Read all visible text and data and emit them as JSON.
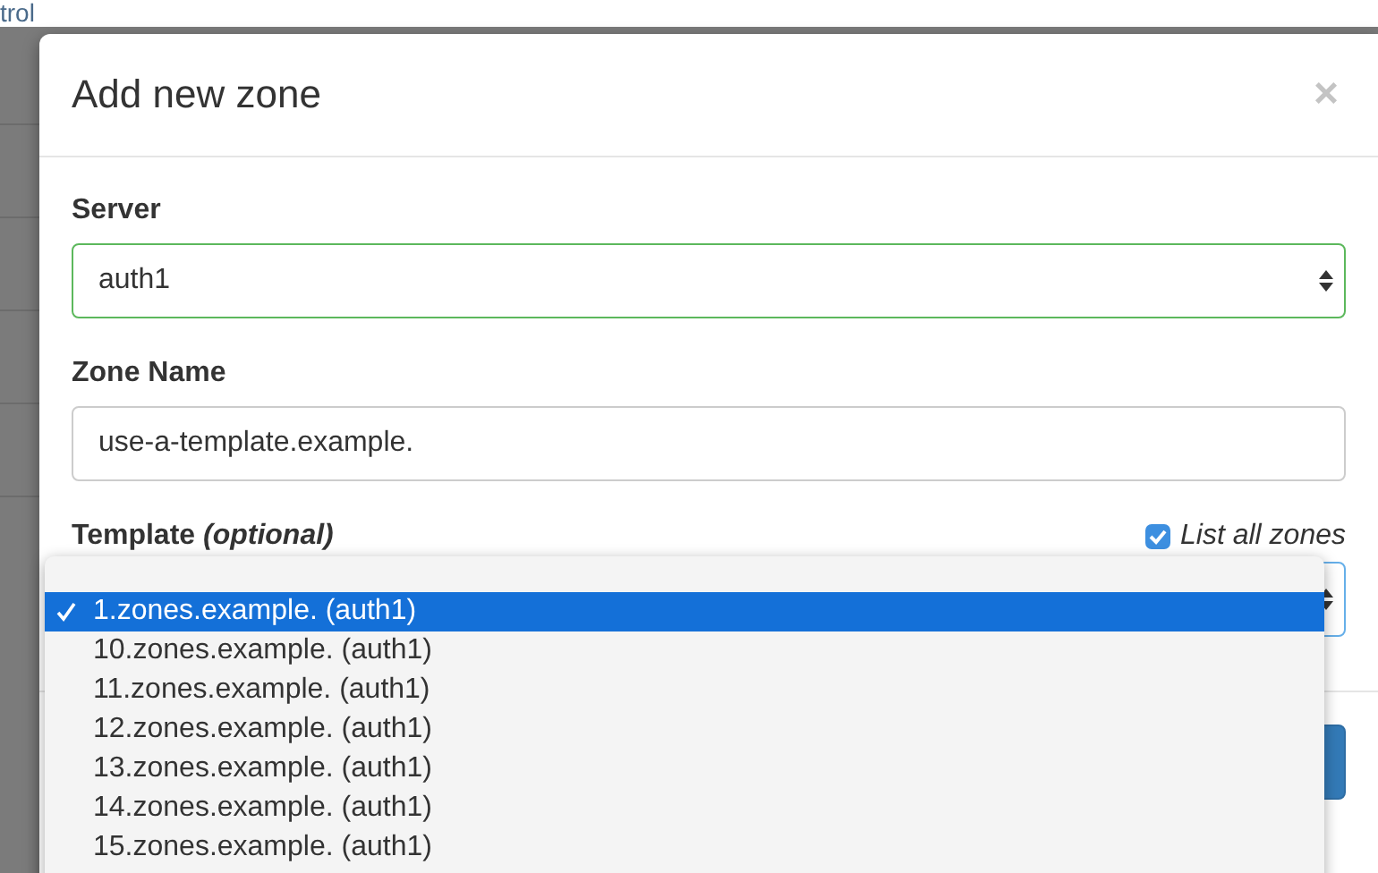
{
  "background": {
    "link_text": "trol"
  },
  "modal": {
    "title": "Add new zone",
    "close": "×",
    "server": {
      "label": "Server",
      "value": "auth1"
    },
    "zone_name": {
      "label": "Zone Name",
      "value": "use-a-template.example."
    },
    "template": {
      "label": "Template *(optional)*",
      "list_all": {
        "label": "List all zones",
        "checked": true
      }
    },
    "dropdown": {
      "options": [
        {
          "label": "1.zones.example. (auth1)",
          "selected": true
        },
        {
          "label": "10.zones.example. (auth1)",
          "selected": false
        },
        {
          "label": "11.zones.example. (auth1)",
          "selected": false
        },
        {
          "label": "12.zones.example. (auth1)",
          "selected": false
        },
        {
          "label": "13.zones.example. (auth1)",
          "selected": false
        },
        {
          "label": "14.zones.example. (auth1)",
          "selected": false
        },
        {
          "label": "15.zones.example. (auth1)",
          "selected": false
        }
      ]
    }
  }
}
